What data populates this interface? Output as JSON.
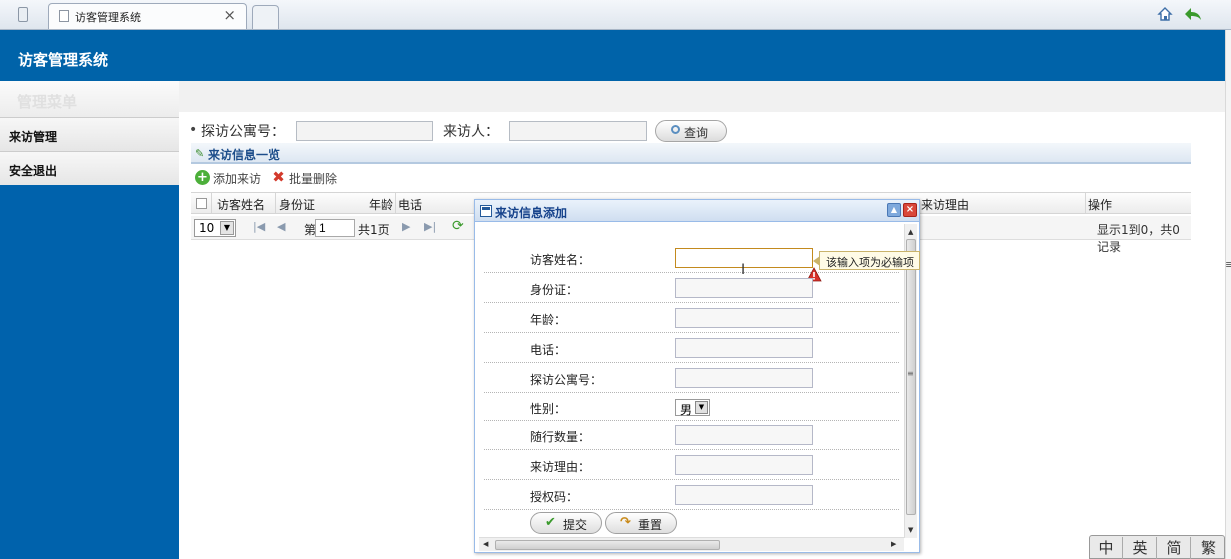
{
  "browser": {
    "tab_title": "访客管理系统",
    "tab_close": "×"
  },
  "header": {
    "title": "访客管理系统"
  },
  "sidebar": {
    "menu_title": "管理菜单",
    "items": [
      {
        "label": "来访管理"
      },
      {
        "label": "安全退出"
      }
    ]
  },
  "search": {
    "bullet": "•",
    "apartment_label": "探访公寓号：",
    "apartment_value": "",
    "visitor_label": "来访人：",
    "visitor_value": "",
    "query_button": "查询"
  },
  "panel": {
    "title": "来访信息一览"
  },
  "toolbar": {
    "add_label": "添加来访",
    "batch_delete_label": "批量删除"
  },
  "grid": {
    "columns": [
      "访客姓名",
      "身份证",
      "年龄",
      "电话",
      "来访理由",
      "操作"
    ]
  },
  "pager": {
    "page_size": "10",
    "page_prefix": "第",
    "page_value": "1",
    "page_total": "共1页",
    "info": "显示1到0，共0记录"
  },
  "dialog": {
    "title": "来访信息添加",
    "fields": [
      {
        "label": "访客姓名：",
        "value": ""
      },
      {
        "label": "身份证：",
        "value": ""
      },
      {
        "label": "年龄：",
        "value": ""
      },
      {
        "label": "电话：",
        "value": ""
      },
      {
        "label": "探访公寓号：",
        "value": ""
      },
      {
        "label": "性别：",
        "value": "男"
      },
      {
        "label": "随行数量：",
        "value": ""
      },
      {
        "label": "来访理由：",
        "value": ""
      },
      {
        "label": "授权码：",
        "value": ""
      }
    ],
    "validation_tip": "该输入项为必输项",
    "submit_label": "提交",
    "reset_label": "重置"
  },
  "ime": {
    "chars": [
      "中",
      "英",
      "简",
      "繁"
    ]
  },
  "colors": {
    "header_blue": "#0063a9",
    "sidebar_blue": "#0062ac",
    "dialog_border": "#99bbe8",
    "error_red": "#d9473a"
  },
  "icons": {
    "browser": [
      "menu-icon",
      "page-icon",
      "home-icon",
      "back-arrow-icon"
    ],
    "toolbar": [
      "add-icon",
      "delete-icon"
    ],
    "pager": [
      "first-page-icon",
      "prev-page-icon",
      "next-page-icon",
      "last-page-icon",
      "refresh-icon"
    ],
    "dialog": [
      "save-disk-icon",
      "minimize-icon",
      "close-icon",
      "warning-icon",
      "check-icon",
      "reset-arrow-icon"
    ]
  }
}
